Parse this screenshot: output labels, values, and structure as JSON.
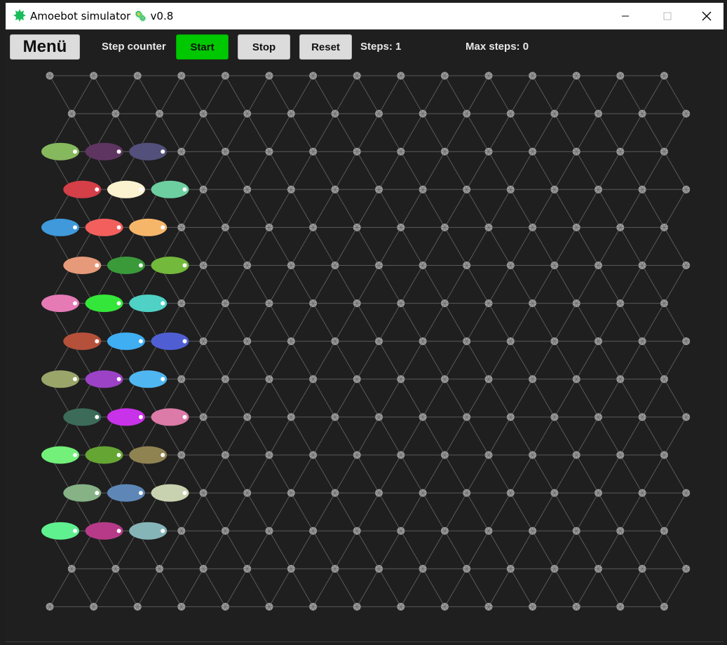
{
  "window": {
    "title": "Amoebot simulator 🦠 v0.8",
    "controls": [
      "minimize-icon",
      "maximize-icon",
      "close-icon"
    ],
    "app_icon": "amoeba-icon",
    "app_icon_color": "#1abc5c"
  },
  "toolbar": {
    "menu_label": "Menü",
    "step_counter_label": "Step counter",
    "start_label": "Start",
    "stop_label": "Stop",
    "reset_label": "Reset",
    "steps_text": "Steps: 1",
    "max_steps_text": "Max steps: 0",
    "start_color": "#00c800"
  },
  "grid": {
    "background": "#1f1f1f",
    "edge_color": "#5a5a5a",
    "node_color": "#9a9a9a",
    "rows": 15,
    "even_row_nodes": 15,
    "odd_row_nodes": 15
  },
  "amoebots": [
    {
      "row": 2,
      "col": 0,
      "color": "#86b85e"
    },
    {
      "row": 2,
      "col": 1,
      "color": "#5e3560"
    },
    {
      "row": 2,
      "col": 2,
      "color": "#53507b"
    },
    {
      "row": 3,
      "col": 0,
      "color": "#d43f48"
    },
    {
      "row": 3,
      "col": 1,
      "color": "#fbf2cf"
    },
    {
      "row": 3,
      "col": 2,
      "color": "#6dcfa0"
    },
    {
      "row": 4,
      "col": 0,
      "color": "#3f99db"
    },
    {
      "row": 4,
      "col": 1,
      "color": "#f25f5c"
    },
    {
      "row": 4,
      "col": 2,
      "color": "#f6b66a"
    },
    {
      "row": 5,
      "col": 0,
      "color": "#e69a7a"
    },
    {
      "row": 5,
      "col": 1,
      "color": "#3a9a3a"
    },
    {
      "row": 5,
      "col": 2,
      "color": "#73b93b"
    },
    {
      "row": 6,
      "col": 0,
      "color": "#e57ab5"
    },
    {
      "row": 6,
      "col": 1,
      "color": "#35e63a"
    },
    {
      "row": 6,
      "col": 2,
      "color": "#4fd1c5"
    },
    {
      "row": 7,
      "col": 0,
      "color": "#b5503b"
    },
    {
      "row": 7,
      "col": 1,
      "color": "#3faef2"
    },
    {
      "row": 7,
      "col": 2,
      "color": "#4f5fd3"
    },
    {
      "row": 8,
      "col": 0,
      "color": "#9aa56a"
    },
    {
      "row": 8,
      "col": 1,
      "color": "#9b42c6"
    },
    {
      "row": 8,
      "col": 2,
      "color": "#4fb6f2"
    },
    {
      "row": 9,
      "col": 0,
      "color": "#3c6b5a"
    },
    {
      "row": 9,
      "col": 1,
      "color": "#c832e8"
    },
    {
      "row": 9,
      "col": 2,
      "color": "#dc7aa8"
    },
    {
      "row": 10,
      "col": 0,
      "color": "#72f07a"
    },
    {
      "row": 10,
      "col": 1,
      "color": "#64a534"
    },
    {
      "row": 10,
      "col": 2,
      "color": "#8f8352"
    },
    {
      "row": 11,
      "col": 0,
      "color": "#86b286"
    },
    {
      "row": 11,
      "col": 1,
      "color": "#5e87b8"
    },
    {
      "row": 11,
      "col": 2,
      "color": "#c8d2b0"
    },
    {
      "row": 12,
      "col": 0,
      "color": "#5ff090"
    },
    {
      "row": 12,
      "col": 1,
      "color": "#b63a88"
    },
    {
      "row": 12,
      "col": 2,
      "color": "#86b5b8"
    }
  ]
}
